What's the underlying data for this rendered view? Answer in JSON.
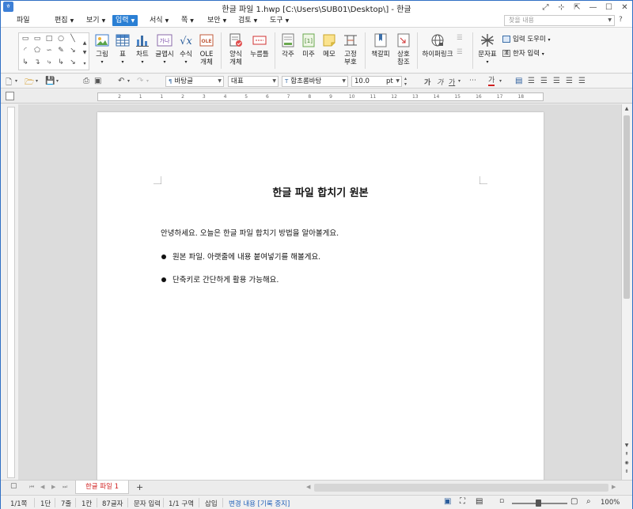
{
  "window": {
    "title": "한글 파일 1.hwp [C:\\Users\\SUB01\\Desktop\\] - 한글"
  },
  "menu": {
    "items": [
      {
        "label": "파일"
      },
      {
        "label": "편집"
      },
      {
        "label": "보기"
      },
      {
        "label": "입력"
      },
      {
        "label": "서식"
      },
      {
        "label": "쪽"
      },
      {
        "label": "보안"
      },
      {
        "label": "검토"
      },
      {
        "label": "도구"
      }
    ],
    "active": "입력",
    "search_placeholder": "찾을 내용"
  },
  "ribbon": {
    "buttons": [
      {
        "label": "그림",
        "icon": "picture-icon"
      },
      {
        "label": "표",
        "icon": "table-icon"
      },
      {
        "label": "차트",
        "icon": "chart-icon"
      },
      {
        "label": "글맵시",
        "icon": "wordart-icon"
      },
      {
        "label": "수식",
        "icon": "formula-icon"
      },
      {
        "label": "OLE",
        "label2": "개체",
        "icon": "ole-icon"
      },
      {
        "label": "양식",
        "label2": "개체",
        "icon": "form-icon"
      },
      {
        "label": "누름틀",
        "icon": "click-field-icon"
      },
      {
        "label": "각주",
        "icon": "footnote-icon"
      },
      {
        "label": "미주",
        "icon": "endnote-icon"
      },
      {
        "label": "메모",
        "icon": "memo-icon"
      },
      {
        "label": "고정",
        "label2": "부호",
        "icon": "fixed-symbol-icon"
      },
      {
        "label": "책갈피",
        "icon": "bookmark-icon"
      },
      {
        "label": "상호",
        "label2": "참조",
        "icon": "cross-ref-icon"
      },
      {
        "label": "하이퍼링크",
        "icon": "hyperlink-icon"
      },
      {
        "label": "문자표",
        "icon": "char-map-icon"
      }
    ],
    "side_items": {
      "input_helper": "입력 도우미",
      "hanja_input": "한자 입력"
    }
  },
  "format_toolbar": {
    "style": "바탕글",
    "lang": "대표",
    "font": "함초롬바탕",
    "size": "10.0",
    "unit": "pt",
    "bold_glyph": "가",
    "italic_glyph": "가",
    "underline_glyph": "가",
    "font_color_glyph": "가"
  },
  "ruler": {
    "ticks": [
      "2",
      "1",
      "1",
      "2",
      "3",
      "4",
      "5",
      "6",
      "7",
      "8",
      "9",
      "10",
      "11",
      "12",
      "13",
      "14",
      "15",
      "16",
      "17",
      "18"
    ]
  },
  "document": {
    "title": "한글 파일 합치기 원본",
    "paragraph": "안녕하세요. 오늘은 한글 파일 합치기 방법을 알아볼게요.",
    "bullets": [
      "원본 파일. 아랫줄에 내용 붙여넣기를 해볼게요.",
      "단축키로 간단하게 활용 가능해요."
    ]
  },
  "tabs": {
    "doc_tab": "한글 파일 1",
    "add": "+"
  },
  "status": {
    "page": "1/1쪽",
    "section": "1단",
    "line": "7줄",
    "column": "1칸",
    "chars": "87글자",
    "input_mode": "문자 입력",
    "zone": "1/1 구역",
    "insert": "삽입",
    "track": "변경 내용 [기록 중지]",
    "zoom": "100%"
  },
  "colors": {
    "accent": "#2a7fd4",
    "doc_tab_text": "#d02020",
    "status_track": "#1e5fb8"
  }
}
